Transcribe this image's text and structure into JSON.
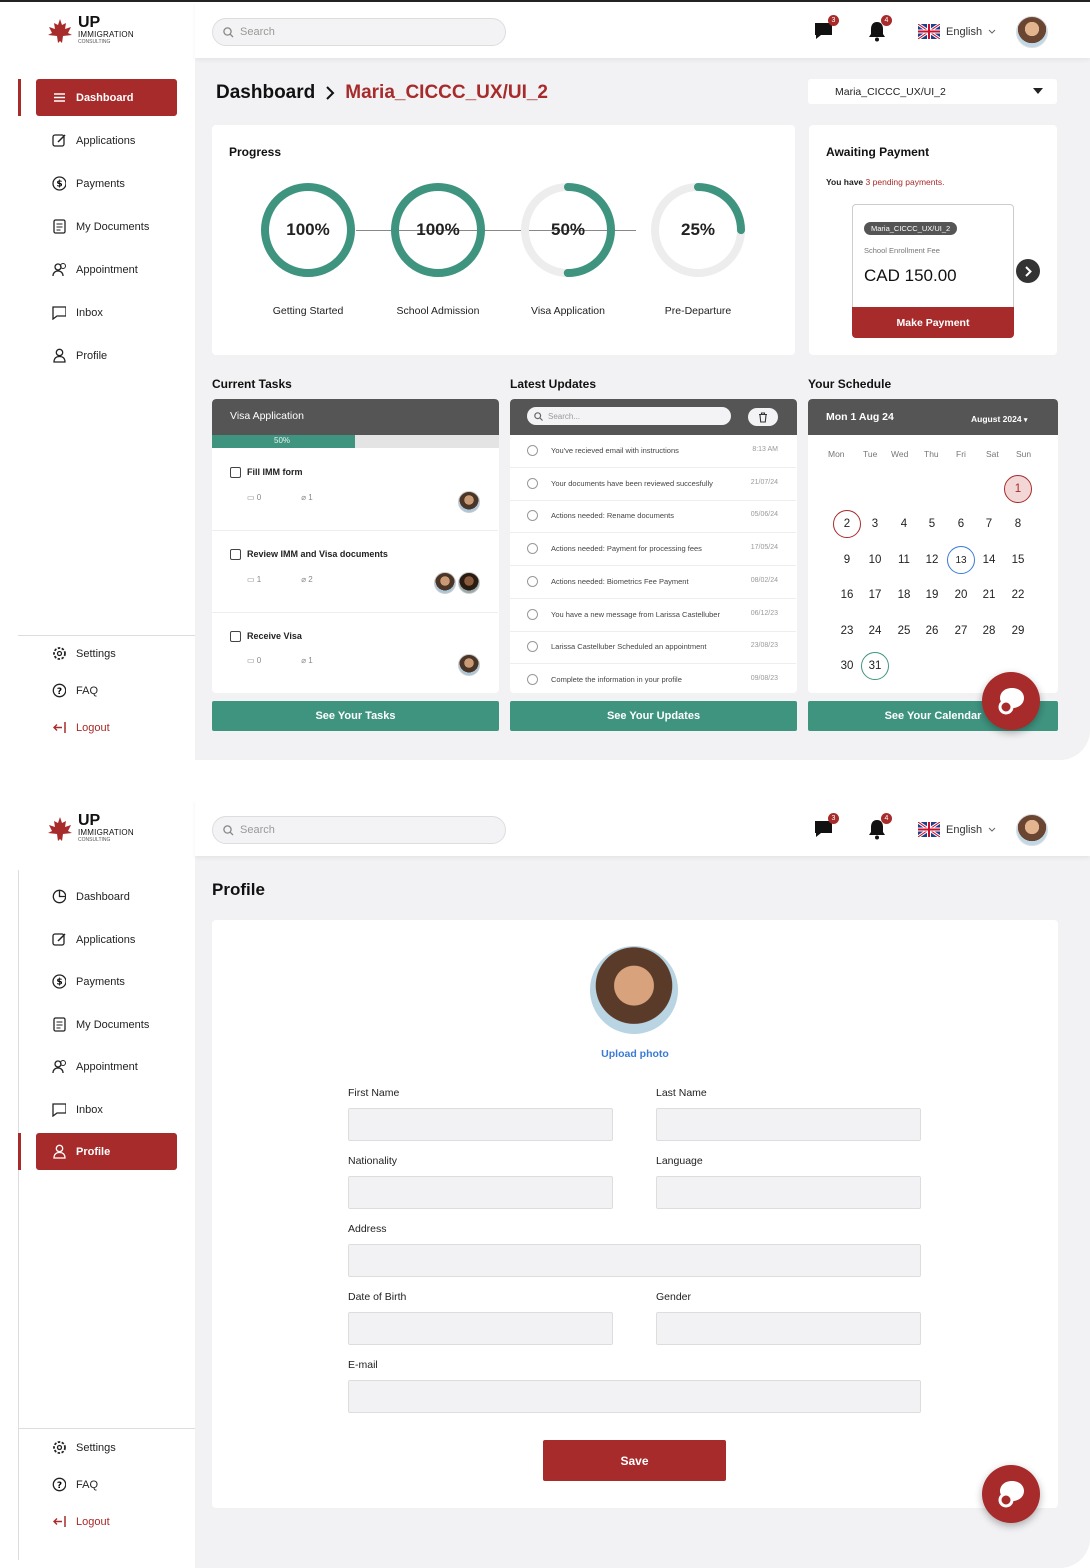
{
  "brand": {
    "name": "UP",
    "sub": "IMMIGRATION",
    "sub2": "CONSULTING"
  },
  "topbar": {
    "search_placeholder": "Search",
    "messages_badge": "3",
    "notifications_badge": "4",
    "language": "English"
  },
  "sidebar": {
    "items": [
      {
        "label": "Dashboard"
      },
      {
        "label": "Applications"
      },
      {
        "label": "Payments"
      },
      {
        "label": "My Documents"
      },
      {
        "label": "Appointment"
      },
      {
        "label": "Inbox"
      },
      {
        "label": "Profile"
      }
    ],
    "bottom": [
      {
        "label": "Settings"
      },
      {
        "label": "FAQ"
      },
      {
        "label": "Logout"
      }
    ]
  },
  "dashboard": {
    "title": "Dashboard",
    "crumb": "Maria_CICCC_UX/UI_2",
    "select_value": "Maria_CICCC_UX/UI_2",
    "progress": {
      "title": "Progress",
      "steps": [
        {
          "label": "Getting Started",
          "value": 100,
          "text": "100%"
        },
        {
          "label": "School Admission",
          "value": 100,
          "text": "100%"
        },
        {
          "label": "Visa Application",
          "value": 50,
          "text": "50%"
        },
        {
          "label": "Pre-Departure",
          "value": 25,
          "text": "25%"
        }
      ]
    },
    "payment": {
      "title": "Awaiting Payment",
      "text_pre": "You have",
      "text_highlight": "3 pending payments.",
      "tag": "Maria_CICCC_UX/UI_2",
      "item": "School Enrollment Fee",
      "amount": "CAD 150.00",
      "button": "Make Payment"
    },
    "tasks": {
      "title": "Current Tasks",
      "panel": "Visa Application",
      "progress_text": "50%",
      "progress": 0.5,
      "items": [
        {
          "title": "Fill IMM form",
          "comments": "0",
          "attachments": "1"
        },
        {
          "title": "Review IMM and Visa documents",
          "comments": "1",
          "attachments": "2"
        },
        {
          "title": "Receive Visa",
          "comments": "0",
          "attachments": "1"
        }
      ],
      "button": "See Your Tasks"
    },
    "updates": {
      "title": "Latest Updates",
      "search_placeholder": "Search...",
      "items": [
        {
          "text": "You've recieved email with instructions",
          "date": "8:13 AM"
        },
        {
          "text": "Your documents have been reviewed succesfully",
          "date": "21/07/24"
        },
        {
          "text": "Actions needed: Rename documents",
          "date": "05/06/24"
        },
        {
          "text": "Actions needed: Payment for processing fees",
          "date": "17/05/24"
        },
        {
          "text": "Actions needed: Biometrics Fee Payment",
          "date": "08/02/24"
        },
        {
          "text": "You have a new message from Larissa Castelluber",
          "date": "06/12/23"
        },
        {
          "text": "Larissa Castelluber Scheduled an appointment",
          "date": "23/08/23"
        },
        {
          "text": "Complete the information in your profile",
          "date": "09/08/23"
        }
      ],
      "button": "See Your Updates"
    },
    "schedule": {
      "title": "Your Schedule",
      "date": "Mon 1 Aug 24",
      "month": "August 2024",
      "weekdays": [
        "Mon",
        "Tue",
        "Wed",
        "Thu",
        "Fri",
        "Sat",
        "Sun"
      ],
      "days": [
        "1",
        "2",
        "3",
        "4",
        "5",
        "6",
        "7",
        "8",
        "9",
        "10",
        "11",
        "12",
        "13",
        "14",
        "15",
        "16",
        "17",
        "18",
        "19",
        "20",
        "21",
        "22",
        "23",
        "24",
        "25",
        "26",
        "27",
        "28",
        "29",
        "30",
        "31"
      ],
      "button": "See Your Calendar"
    }
  },
  "profile": {
    "title": "Profile",
    "upload": "Upload photo",
    "fields": {
      "first": "First Name",
      "last": "Last Name",
      "nationality": "Nationality",
      "language": "Language",
      "address": "Address",
      "dob": "Date of Birth",
      "gender": "Gender",
      "email": "E-mail"
    },
    "save": "Save"
  },
  "colors": {
    "brand": "#a72b2a",
    "green": "#3f9480",
    "dark": "#555555"
  }
}
